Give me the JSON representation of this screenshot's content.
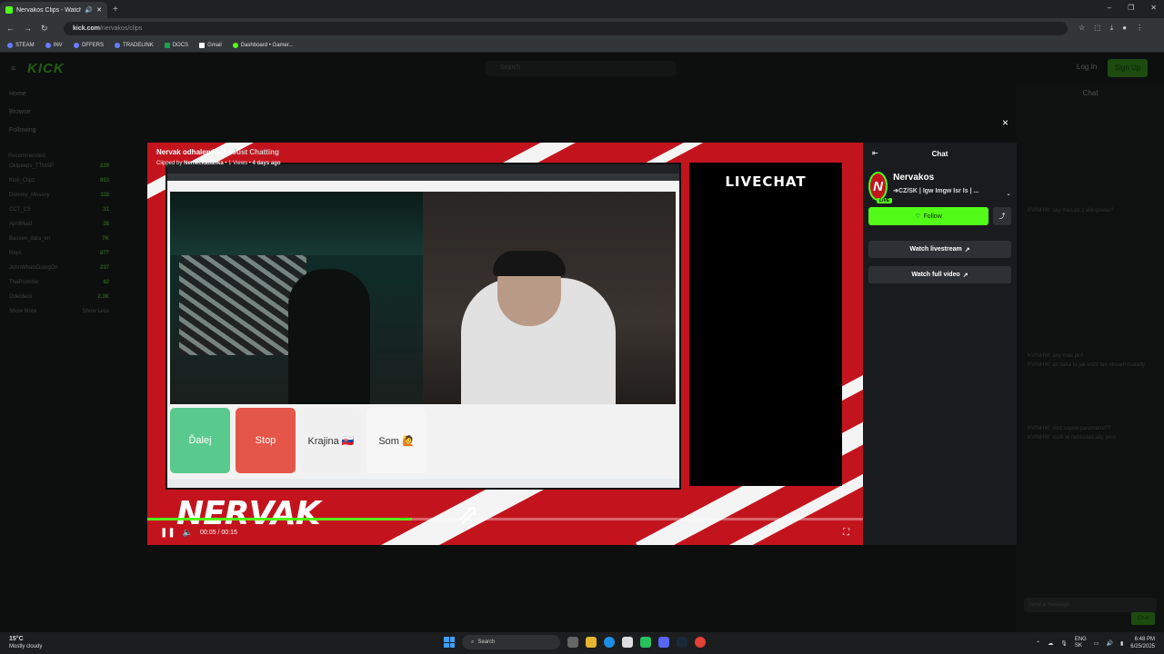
{
  "browser": {
    "tab_title": "Nervakos Clips - Watch Liv",
    "new_tab": "+",
    "url_host": "kick.com",
    "url_path": "/nervakos/clips",
    "window_controls": [
      "–",
      "❐",
      "✕"
    ],
    "bookmarks": [
      "STEAM",
      "INV",
      "OFFERS",
      "TRADELINK",
      "DOCS",
      "Gmail",
      "Dashboard • Gamer..."
    ]
  },
  "kick_bg": {
    "logo": "KICK",
    "search_placeholder": "Search",
    "login": "Log In",
    "signup": "Sign Up",
    "nav": [
      "Home",
      "Browse",
      "Following"
    ],
    "recommended_label": "Recommended",
    "channels": [
      {
        "name": "Oklpeeps_TTMSP",
        "count": "229"
      },
      {
        "name": "Kick_Clipz",
        "count": "853"
      },
      {
        "name": "Dommy_Mossoy",
        "count": "118"
      },
      {
        "name": "CCT_CS",
        "count": "31"
      },
      {
        "name": "AprilMaid",
        "count": "38"
      },
      {
        "name": "Bassen_data_en",
        "count": "7K"
      },
      {
        "name": "Rhys",
        "count": "877"
      },
      {
        "name": "JohnWhatsDoingOn",
        "count": "237"
      },
      {
        "name": "ThaPromise",
        "count": "82"
      },
      {
        "name": "Odeldeck",
        "count": "2.3K"
      }
    ],
    "show_more": "Show More",
    "show_less": "Show Less",
    "right_chat_header": "Chat",
    "bg_chat_lines": [
      "KVINHW: say mas pc z aliexpresu?",
      "KVINHW: any mas pc?",
      "KVINHW: as saka to jak vozit ten stream malady",
      "KVINHW: vlez sopon parametre??",
      "KVINHW: rozili te nehnutas aby jeno"
    ],
    "send_placeholder": "Send a message",
    "chat_button": "Chat"
  },
  "clip": {
    "close": "×",
    "title": "Nervak odhalený xD",
    "category": "Just Chatting",
    "clipped_by_prefix": "Clipped by",
    "clipped_by": "Nemeckabanka",
    "views": "1 Views",
    "age": "4 days ago",
    "buttons": [
      "Ďalej",
      "Stop",
      "Krajina 🇸🇰",
      "Som 🙋"
    ],
    "livechat_label": "LIVECHAT",
    "brand_text": "NERVAK",
    "time_current": "00:05",
    "time_total": "00:15",
    "progress": 0.37
  },
  "chat_panel": {
    "header": "Chat",
    "channel_name": "Nervakos",
    "live_badge": "LIVE",
    "stream_title": "➔CZ/SK | Igw Imgw Isr Is | ...",
    "follow_label": "Follow",
    "watch_livestream": "Watch livestream",
    "watch_full_video": "Watch full video"
  },
  "taskbar": {
    "temp": "15°C",
    "weather": "Mostly cloudy",
    "search": "Search",
    "lang": "ENG",
    "region": "SK",
    "time": "6:48 PM",
    "date": "6/25/2025"
  },
  "colors": {
    "kick_green": "#53fc18",
    "clip_red": "#c3141d"
  }
}
